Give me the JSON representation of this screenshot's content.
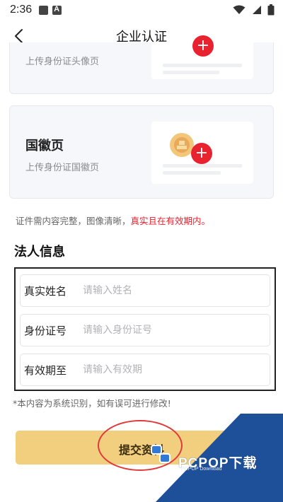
{
  "status_bar": {
    "time": "2:36"
  },
  "nav": {
    "title": "企业认证"
  },
  "id_front_card": {
    "subtitle": "上传身份证头像页"
  },
  "id_back_card": {
    "title": "国徽页",
    "subtitle": "上传身份证国徽页"
  },
  "notice": {
    "prefix": "证件需内容完整，图像清晰，",
    "highlight": "真实且在有效期内。"
  },
  "legal_person": {
    "section_title": "法人信息",
    "fields": [
      {
        "label": "真实姓名",
        "placeholder": "请输入姓名",
        "value": ""
      },
      {
        "label": "身份证号",
        "placeholder": "请输入身份证号",
        "value": ""
      },
      {
        "label": "有效期至",
        "placeholder": "请输入有效期",
        "value": ""
      }
    ]
  },
  "tip": "*本内容为系统识别，如有误可进行修改!",
  "submit": {
    "label": "提交资料"
  },
  "watermark": {
    "text": "PCPOP下载",
    "sub": "PCPOP Download"
  },
  "colors": {
    "accent_red": "#e8222f",
    "button_gold": "#f1cf7f",
    "card_bg": "#f6f7fb",
    "watermark_blue": "#1e4f99"
  }
}
